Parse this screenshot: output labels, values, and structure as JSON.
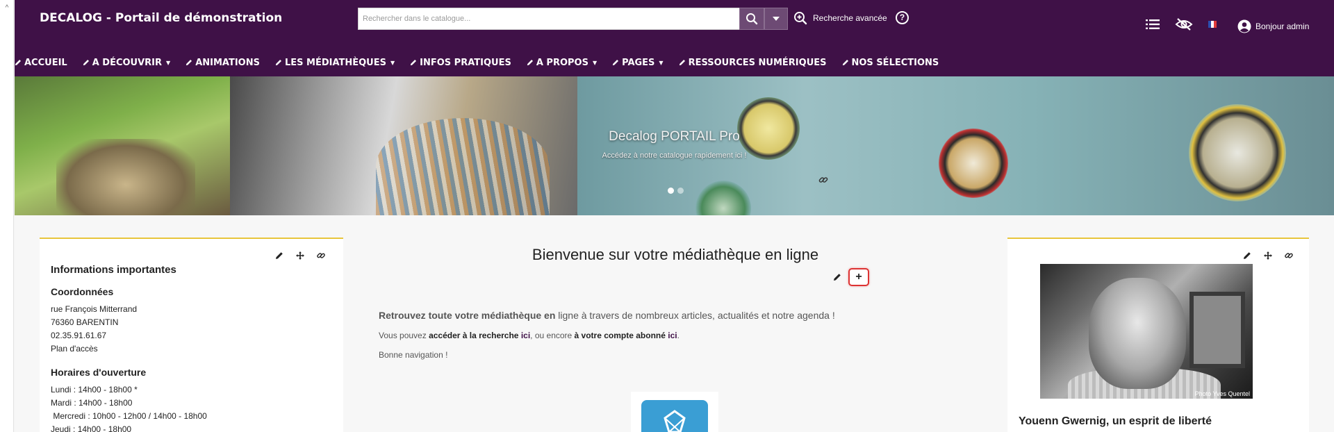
{
  "header": {
    "brand": "DECALOG - Portail de démonstration",
    "search_placeholder": "Rechercher dans le catalogue...",
    "advanced_search": "Recherche avancée",
    "user_greeting": "Bonjour admin"
  },
  "nav": {
    "items": [
      {
        "label": "ACCUEIL",
        "dropdown": false
      },
      {
        "label": "A DÉCOUVRIR",
        "dropdown": true
      },
      {
        "label": "ANIMATIONS",
        "dropdown": false
      },
      {
        "label": "LES MÉDIATHÈQUES",
        "dropdown": true
      },
      {
        "label": "INFOS PRATIQUES",
        "dropdown": false
      },
      {
        "label": "A PROPOS",
        "dropdown": true
      },
      {
        "label": "PAGES",
        "dropdown": true
      },
      {
        "label": "RESSOURCES NUMÉRIQUES",
        "dropdown": false
      },
      {
        "label": "NOS SÉLECTIONS",
        "dropdown": false
      }
    ]
  },
  "banner": {
    "title": "Decalog PORTAIL Pro",
    "subtitle": "Accédez à notre catalogue rapidement ici !"
  },
  "left_card": {
    "title": "Informations importantes",
    "contact_heading": "Coordonnées",
    "contact_lines": [
      "rue François Mitterrand",
      "76360 BARENTIN",
      "02.35.91.61.67",
      "Plan d'accès"
    ],
    "hours_heading": "Horaires d'ouverture",
    "hours_lines": [
      "Lundi : 14h00 - 18h00 *",
      "Mardi : 14h00 - 18h00",
      " Mercredi : 10h00 - 12h00 / 14h00 - 18h00",
      "Jeudi : 14h00 - 18h00"
    ]
  },
  "main": {
    "welcome": "Bienvenue sur votre médiathèque en ligne",
    "plus_label": "+",
    "lead_bold": "Retrouvez toute votre médiathèque en",
    "lead_rest": " ligne à travers de nombreux articles, actualités et notre agenda !",
    "line2_a": "Vous pouvez ",
    "line2_b": "accéder à la recherche",
    "line2_c": " ",
    "line2_d": "ici",
    "line2_e": ", ou encore ",
    "line2_f": "à votre compte abonné",
    "line2_g": " ",
    "line2_h": "ici",
    "line2_i": ".",
    "line3": "Bonne navigation !"
  },
  "right_card": {
    "photo_credit": "Photo Yves Quentel",
    "title": "Youenn Gwernig, un esprit de liberté"
  },
  "colors": {
    "header_bg": "#3f1147",
    "accent_yellow": "#e8c53c",
    "highlight_red": "#dd3333"
  },
  "icons": [
    "search-icon",
    "caret-down-icon",
    "zoom-plus-icon",
    "help-icon",
    "list-icon",
    "eye-slash-icon",
    "flag-fr-icon",
    "user-icon",
    "pencil-icon",
    "move-icon",
    "link-icon"
  ]
}
